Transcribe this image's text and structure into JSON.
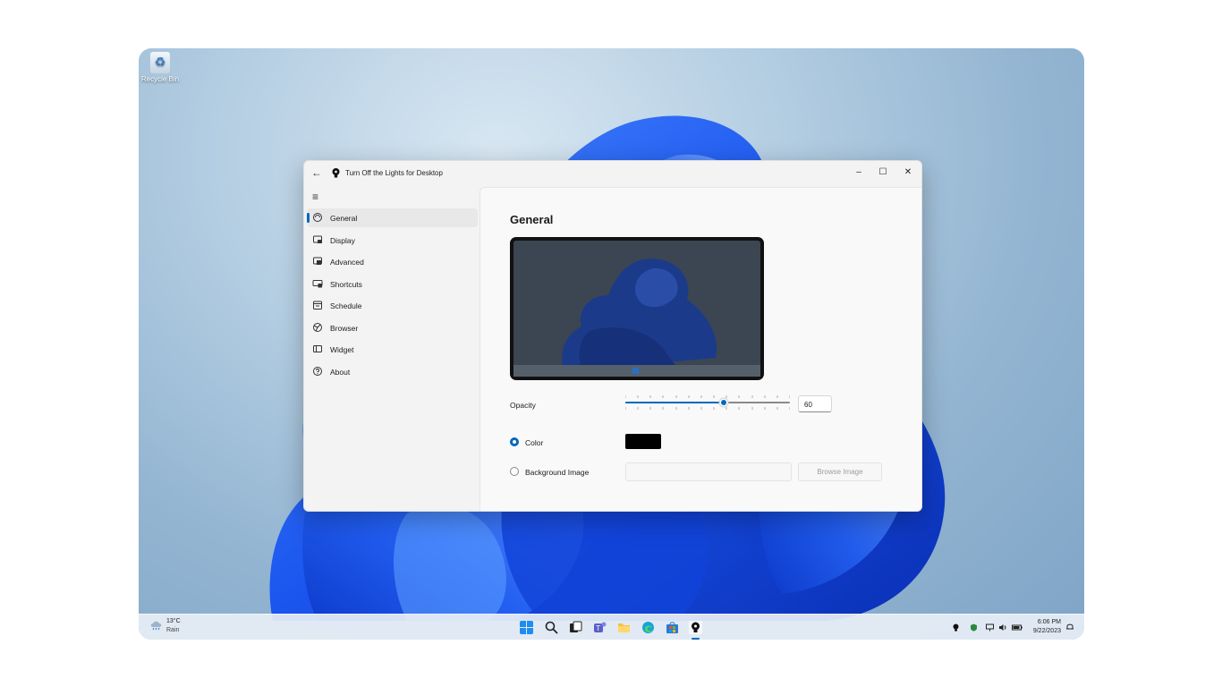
{
  "desktop": {
    "recycle_bin_label": "Recycle Bin",
    "accent_color": "#1f5fff"
  },
  "window": {
    "title": "Turn Off the Lights for Desktop",
    "back_icon": "back-arrow-icon",
    "minimize_glyph": "–",
    "maximize_glyph": "☐",
    "close_glyph": "✕",
    "menu_glyph": "≡"
  },
  "sidebar": {
    "items": [
      {
        "label": "General",
        "icon": "general-icon",
        "selected": true
      },
      {
        "label": "Display",
        "icon": "display-icon",
        "selected": false
      },
      {
        "label": "Advanced",
        "icon": "advanced-icon",
        "selected": false
      },
      {
        "label": "Shortcuts",
        "icon": "keyboard-icon",
        "selected": false
      },
      {
        "label": "Schedule",
        "icon": "calendar-icon",
        "selected": false
      },
      {
        "label": "Browser",
        "icon": "globe-icon",
        "selected": false
      },
      {
        "label": "Widget",
        "icon": "widget-icon",
        "selected": false
      },
      {
        "label": "About",
        "icon": "help-icon",
        "selected": false
      }
    ]
  },
  "general": {
    "heading": "General",
    "opacity_label": "Opacity",
    "opacity_value": "60",
    "opacity_percent": 60,
    "color_label": "Color",
    "color_value": "#000000",
    "color_selected": true,
    "background_image_label": "Background Image",
    "background_image_value": "",
    "browse_label": "Browse Image"
  },
  "taskbar": {
    "weather_temp": "13°C",
    "weather_condition": "Rain",
    "apps": [
      "start-icon",
      "search-icon",
      "task-view-icon",
      "teams-icon",
      "file-explorer-icon",
      "edge-icon",
      "store-icon",
      "turn-off-the-lights-icon"
    ],
    "tray_icons": [
      "lamp-icon",
      "security-icon",
      "network-icon",
      "volume-icon",
      "battery-icon"
    ],
    "time": "6:06 PM",
    "date": "9/22/2023"
  }
}
